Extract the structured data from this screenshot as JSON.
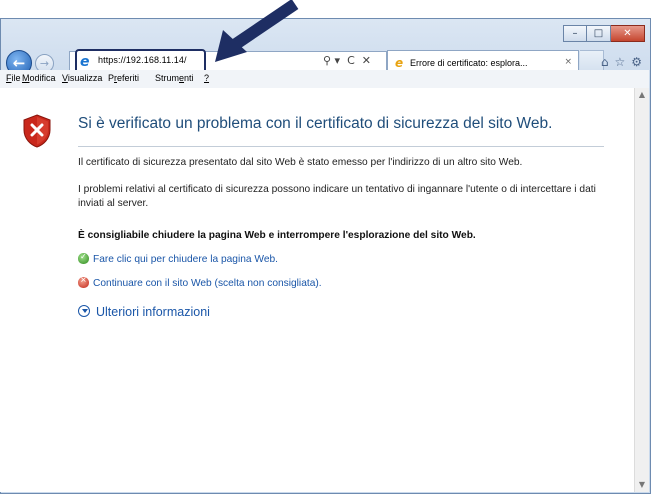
{
  "browser": {
    "address_url": "https://192.168.11.14/",
    "tab_title": "Errore di certificato: esplora...",
    "tab_close": "×",
    "address_tools": [
      "⚲ ▾",
      "C",
      "✕"
    ],
    "right_icons": [
      "⌂",
      "☆",
      "⚙"
    ],
    "window_controls": {
      "minimize": "–",
      "maximize": "□",
      "close": "✕"
    }
  },
  "menu": {
    "items": [
      {
        "u": "F",
        "rest": "ile"
      },
      {
        "u": "M",
        "rest": "odifica"
      },
      {
        "u": "V",
        "rest": "isualizza"
      },
      {
        "pre": "P",
        "u": "r",
        "rest": "eferiti"
      },
      {
        "pre": "Strum",
        "u": "e",
        "rest": "nti"
      },
      {
        "u": "?",
        "rest": ""
      }
    ]
  },
  "page": {
    "title": "Si è verificato un problema con il certificato di sicurezza del sito Web.",
    "para1": "Il certificato di sicurezza presentato dal sito Web è stato emesso per l'indirizzo di un altro sito Web.",
    "para2": "I problemi relativi al certificato di sicurezza possono indicare un tentativo di ingannare l'utente o di intercettare i dati inviati al server.",
    "recommendation": "È consigliabile chiudere la pagina Web e interrompere l'esplorazione del sito Web.",
    "close_link": "Fare clic qui per chiudere la pagina Web.",
    "continue_link": "Continuare con il sito Web (scelta non consigliata).",
    "more_info": "Ulteriori informazioni"
  },
  "colors": {
    "title": "#1f4d7a",
    "link": "#1a56a8",
    "annotation_arrow": "#1e2e63"
  }
}
